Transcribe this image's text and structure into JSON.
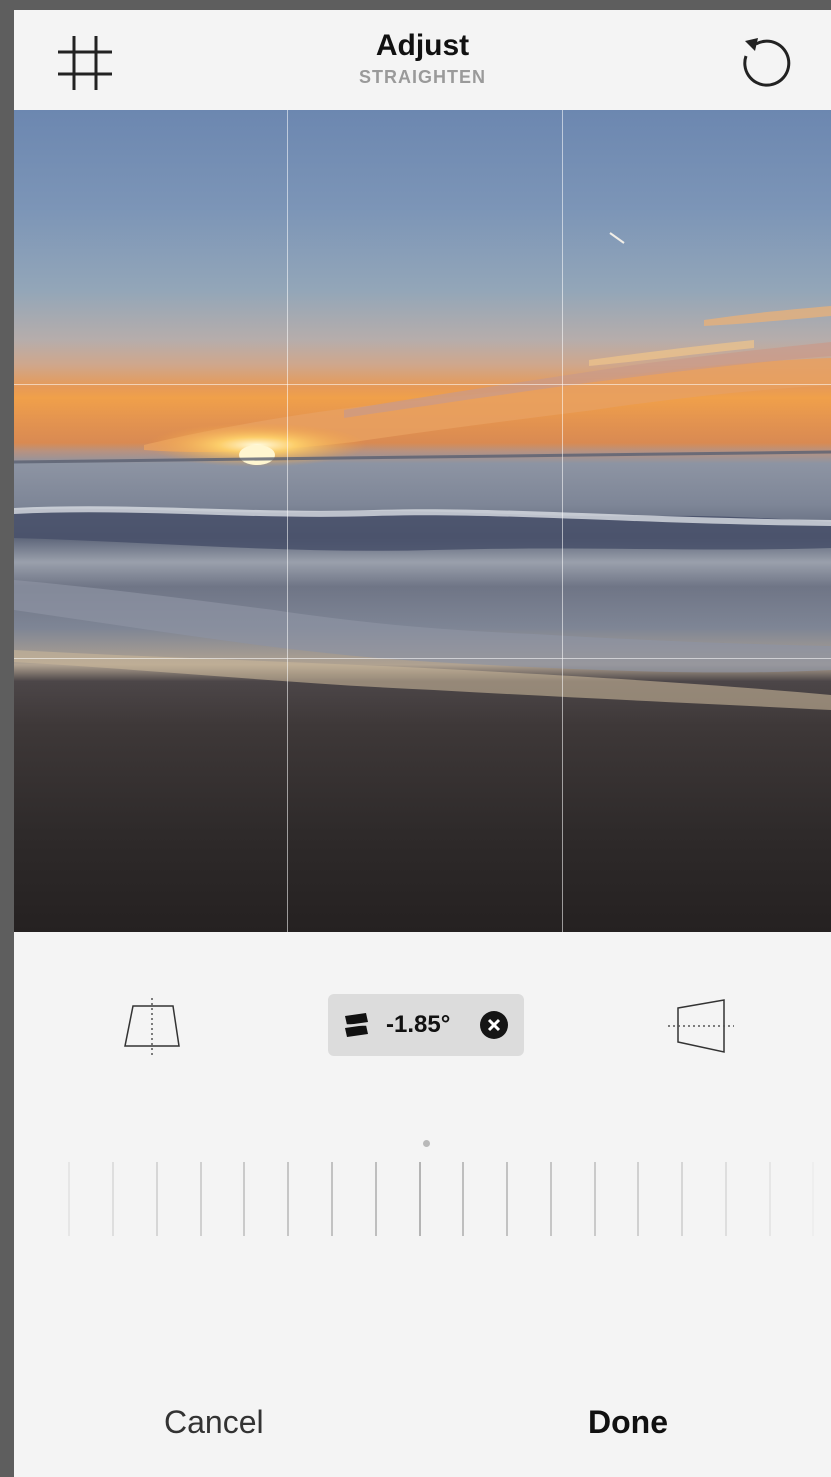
{
  "header": {
    "title": "Adjust",
    "subtitle": "STRAIGHTEN",
    "grid_icon": "grid-icon",
    "reset_icon": "rotate-reset-icon"
  },
  "photo": {
    "subject": "sunset-over-ocean-beach",
    "grid": "3x3"
  },
  "tools": {
    "vertical_perspective_icon": "vertical-perspective-icon",
    "horizontal_perspective_icon": "horizontal-perspective-icon",
    "straighten_icon": "straighten-icon",
    "angle_value": "-1.85°",
    "clear_icon": "clear-icon"
  },
  "dial": {
    "value_degrees": -1.85
  },
  "footer": {
    "cancel_label": "Cancel",
    "done_label": "Done"
  },
  "colors": {
    "background": "#f4f4f4",
    "text_primary": "#111111",
    "text_secondary": "#9a9a9a",
    "chip_background": "#dcdcdc"
  }
}
